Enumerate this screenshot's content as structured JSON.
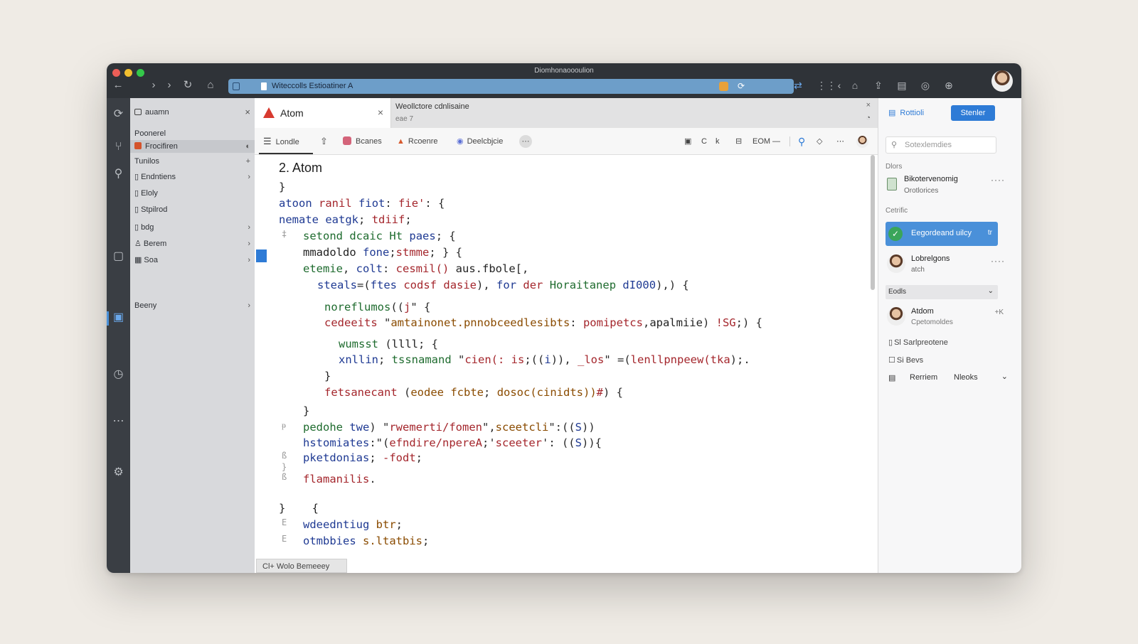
{
  "window": {
    "title": "Diomhonaoooulion"
  },
  "browser": {
    "url": "Witeccolls Estioatiner A",
    "nav": {
      "back": "←",
      "forward": "›",
      "forward2": "›",
      "reload": "↻",
      "home": "⌂"
    }
  },
  "rail": {
    "icons": [
      "sync-icon",
      "git-icon",
      "search-icon",
      "layout-icon",
      "notes-icon",
      "clock-icon",
      "more-icon",
      "settings-icon"
    ]
  },
  "tree": {
    "project": "auamn",
    "section": "Poonerel",
    "items": [
      {
        "label": "Frocifiren",
        "selected": true
      },
      {
        "label": "Tunilos"
      },
      {
        "label": "Endntiens"
      },
      {
        "label": "Eloly"
      },
      {
        "label": "Stpilrod"
      },
      {
        "label": "bdg"
      },
      {
        "label": "Berem"
      },
      {
        "label": "Soa"
      }
    ],
    "footer_item": "Beeny"
  },
  "editor": {
    "tab_title": "Atom",
    "second_tab_title": "Weollctore cdnlisaine",
    "second_tab_sub": "eae 7",
    "toolbar": {
      "view_label": "Londle",
      "items": [
        "Bcanes",
        "Rcoenre",
        "Deelcbjcie"
      ],
      "right_items": [
        "C",
        "k",
        "EOM",
        "—"
      ]
    },
    "heading": "2. Atom",
    "status": "Cl+ Wolo Bemeeey"
  },
  "sidebar": {
    "top_link": "Rottioli",
    "top_button": "Stenler",
    "search_placeholder": "Sotexlemdies",
    "group1_label": "Dlors",
    "item1_title": "Bikotervenomig",
    "item1_sub": "Orotlorices",
    "group2_label": "Cetrific",
    "active_item": "Eegordeand uilcy",
    "active_badge": "tr",
    "item2_title": "Lobrelgons",
    "item2_sub": "atch",
    "dropdown_label": "Eodls",
    "item3_title": "Atdom",
    "item3_sub": "Cpetomoldes",
    "item3_badge": "+K",
    "small1": "Sl  Sarlpreotene",
    "small2": "Si  Bevs",
    "footer_left": "Rerriem",
    "footer_right": "Nleoks"
  },
  "colors": {
    "accent": "#2e7bd6",
    "active_item": "#4a90d9",
    "atom_red": "#d73a2f",
    "titlebar": "#2f3338"
  }
}
